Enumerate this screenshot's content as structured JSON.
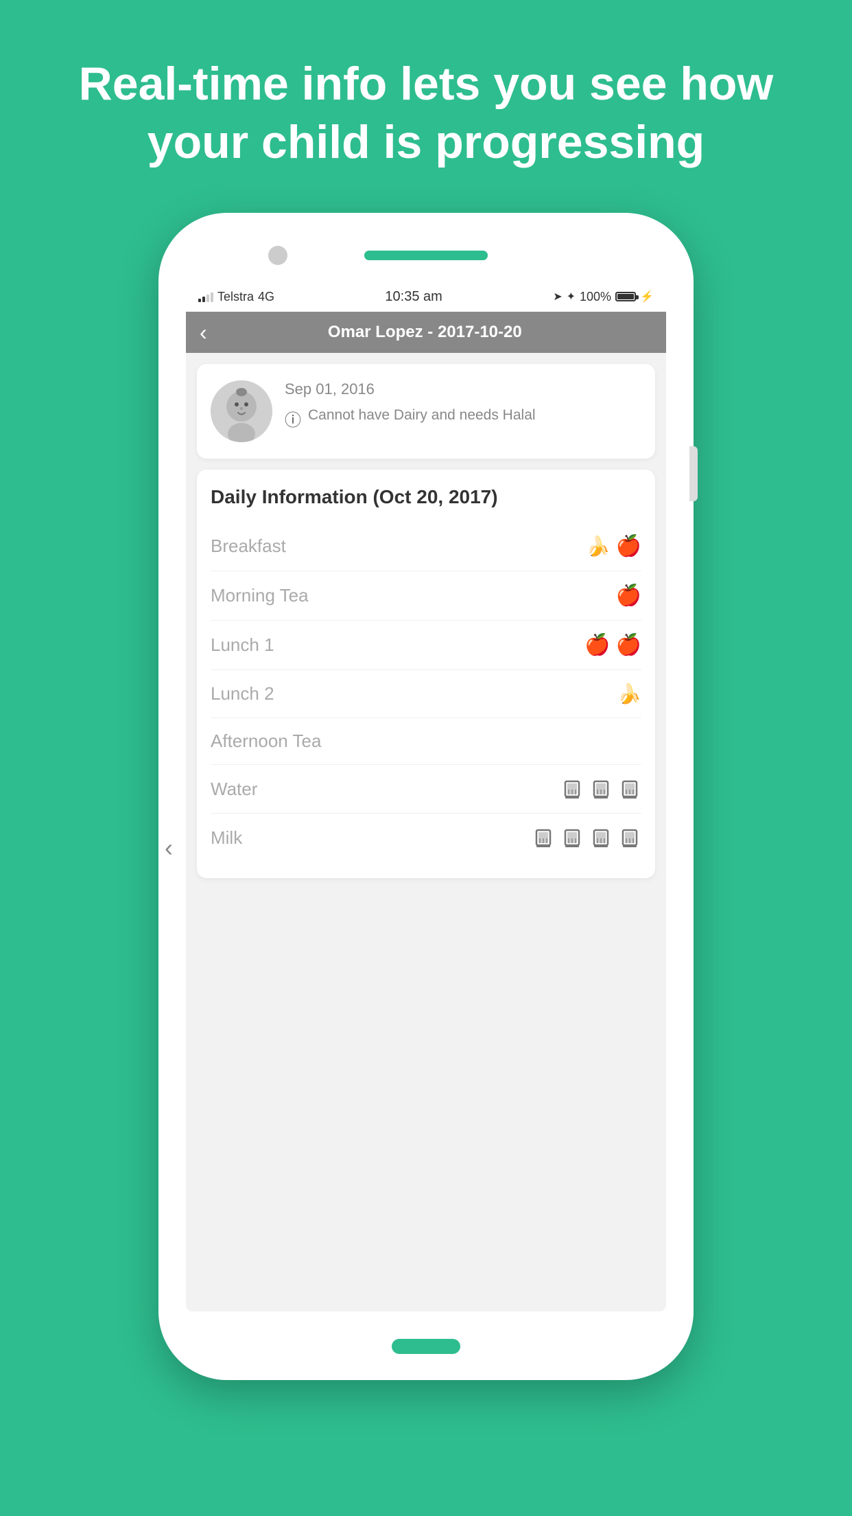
{
  "headline": "Real-time info lets you see how your child is progressing",
  "status_bar": {
    "carrier": "Telstra",
    "network": "4G",
    "time": "10:35 am",
    "battery": "100%"
  },
  "nav": {
    "title": "Omar Lopez - 2017-10-20",
    "back_label": "<"
  },
  "profile": {
    "dob": "Sep 01, 2016",
    "alert_text": "Cannot have Dairy and needs Halal"
  },
  "daily": {
    "title": "Daily Information (Oct 20, 2017)",
    "meals": [
      {
        "label": "Breakfast",
        "icons": [
          "pear",
          "apple"
        ]
      },
      {
        "label": "Morning Tea",
        "icons": [
          "apple"
        ]
      },
      {
        "label": "Lunch 1",
        "icons": [
          "apple",
          "apple"
        ]
      },
      {
        "label": "Lunch 2",
        "icons": [
          "pear"
        ]
      },
      {
        "label": "Afternoon Tea",
        "icons": []
      },
      {
        "label": "Water",
        "icons": [
          "cup",
          "cup",
          "cup"
        ]
      },
      {
        "label": "Milk",
        "icons": [
          "cup",
          "cup",
          "cup",
          "cup"
        ]
      }
    ]
  }
}
